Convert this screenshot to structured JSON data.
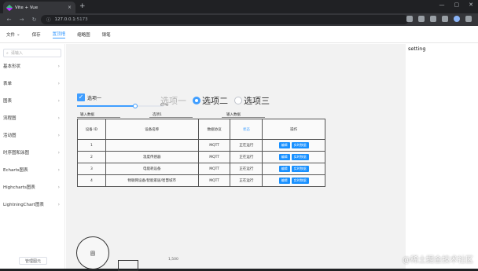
{
  "browser": {
    "tab_title": "Vite + Vue",
    "tab_close": "×",
    "new_tab": "+",
    "window_buttons": [
      "—",
      "▢",
      "✕"
    ],
    "url_host": "127.0.0.1",
    "url_port": ":5173",
    "nav": [
      "←",
      "→",
      "↻"
    ]
  },
  "menubar": {
    "items": [
      {
        "label": "文件",
        "arrow": "⌄"
      },
      {
        "label": "保存"
      },
      {
        "label": "缩略图"
      },
      {
        "label": "钢笔"
      }
    ],
    "active": {
      "label": "置顶槽"
    }
  },
  "sidebar": {
    "search_placeholder": "请输入",
    "items": [
      "基本形状",
      "表单",
      "图表",
      "流程图",
      "活动图",
      "时序图和泳图",
      "Echarts图表",
      "Highcharts图表",
      "LightningChart图表"
    ],
    "footer_button": "管理图元"
  },
  "right_panel": {
    "title": "setting"
  },
  "canvas": {
    "checkbox_label": "选项一",
    "radios": [
      "选项一",
      "选项二",
      "选项三"
    ],
    "slider_value": "67%",
    "slider_fraction": 0.67,
    "input_labels": [
      "输入数据",
      "选项1",
      "输入数据"
    ],
    "table": {
      "headers": [
        "设备 ID",
        "设备名称",
        "数据协议",
        "状态",
        "操作"
      ],
      "rows": [
        {
          "id": "1",
          "name": "",
          "protocol": "MQTT",
          "status": "正在运行"
        },
        {
          "id": "2",
          "name": "温度传感器",
          "protocol": "MQTT",
          "status": "正在运行"
        },
        {
          "id": "3",
          "name": "电能耗设备",
          "protocol": "MQTT",
          "status": "正在运行"
        },
        {
          "id": "4",
          "name": "物联网设备/智能家居/智慧城市",
          "protocol": "MQTT",
          "status": "正在运行"
        }
      ],
      "action_edit": "编辑",
      "action_data": "实时数据"
    },
    "circle_label": "圆",
    "small_text": "1,500"
  },
  "watermark": "@稀土掘金技术社区"
}
